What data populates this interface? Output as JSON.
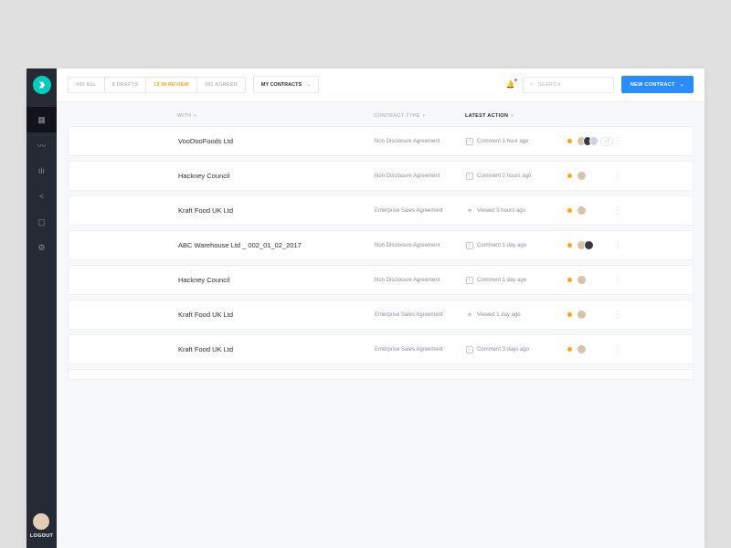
{
  "sidebar": {
    "logout": "LOGOUT"
  },
  "topbar": {
    "tabs": [
      {
        "label": "403 ALL"
      },
      {
        "label": "8 DRAFTS"
      },
      {
        "label": "19 IN REVIEW"
      },
      {
        "label": "391 AGREED"
      }
    ],
    "dropdown": "MY CONTRACTS",
    "search_placeholder": "SEARCH",
    "new_contract": "NEW CONTRACT"
  },
  "headers": {
    "with": "WITH",
    "type": "CONTRACT TYPE",
    "action": "LATEST ACTION"
  },
  "rows": [
    {
      "name": "VooDooFoods Ltd",
      "type": "Non Disclosure Agreement",
      "icon": "comment",
      "action": "Comment 1 hour ago",
      "avatars": 3,
      "more": "+1"
    },
    {
      "name": "Hackney Council",
      "type": "Non Disclosure Agreement",
      "icon": "comment",
      "action": "Comment 2 hours ago",
      "avatars": 1
    },
    {
      "name": "Kraft Food UK Ltd",
      "type": "Enterprise Sales Agreement",
      "icon": "eye",
      "action": "Viewed 3 hours ago",
      "avatars": 1
    },
    {
      "name": "ABC Warehouse Ltd _ 002_01_02_2017",
      "type": "Non Disclosure Agreement",
      "icon": "comment",
      "action": "Comment 1 day ago",
      "avatars": 2
    },
    {
      "name": "Hackney Council",
      "type": "Non Disclosure Agreement",
      "icon": "comment",
      "action": "Comment 1 day ago",
      "avatars": 1
    },
    {
      "name": "Kraft Food UK Ltd",
      "type": "Enterprise Sales Agreement",
      "icon": "eye",
      "action": "Viewed 1 day ago",
      "avatars": 1
    },
    {
      "name": "Kraft Food UK Ltd",
      "type": "Enterprise Sales Agreement",
      "icon": "comment",
      "action": "Comment 3 days ago",
      "avatars": 1
    }
  ]
}
